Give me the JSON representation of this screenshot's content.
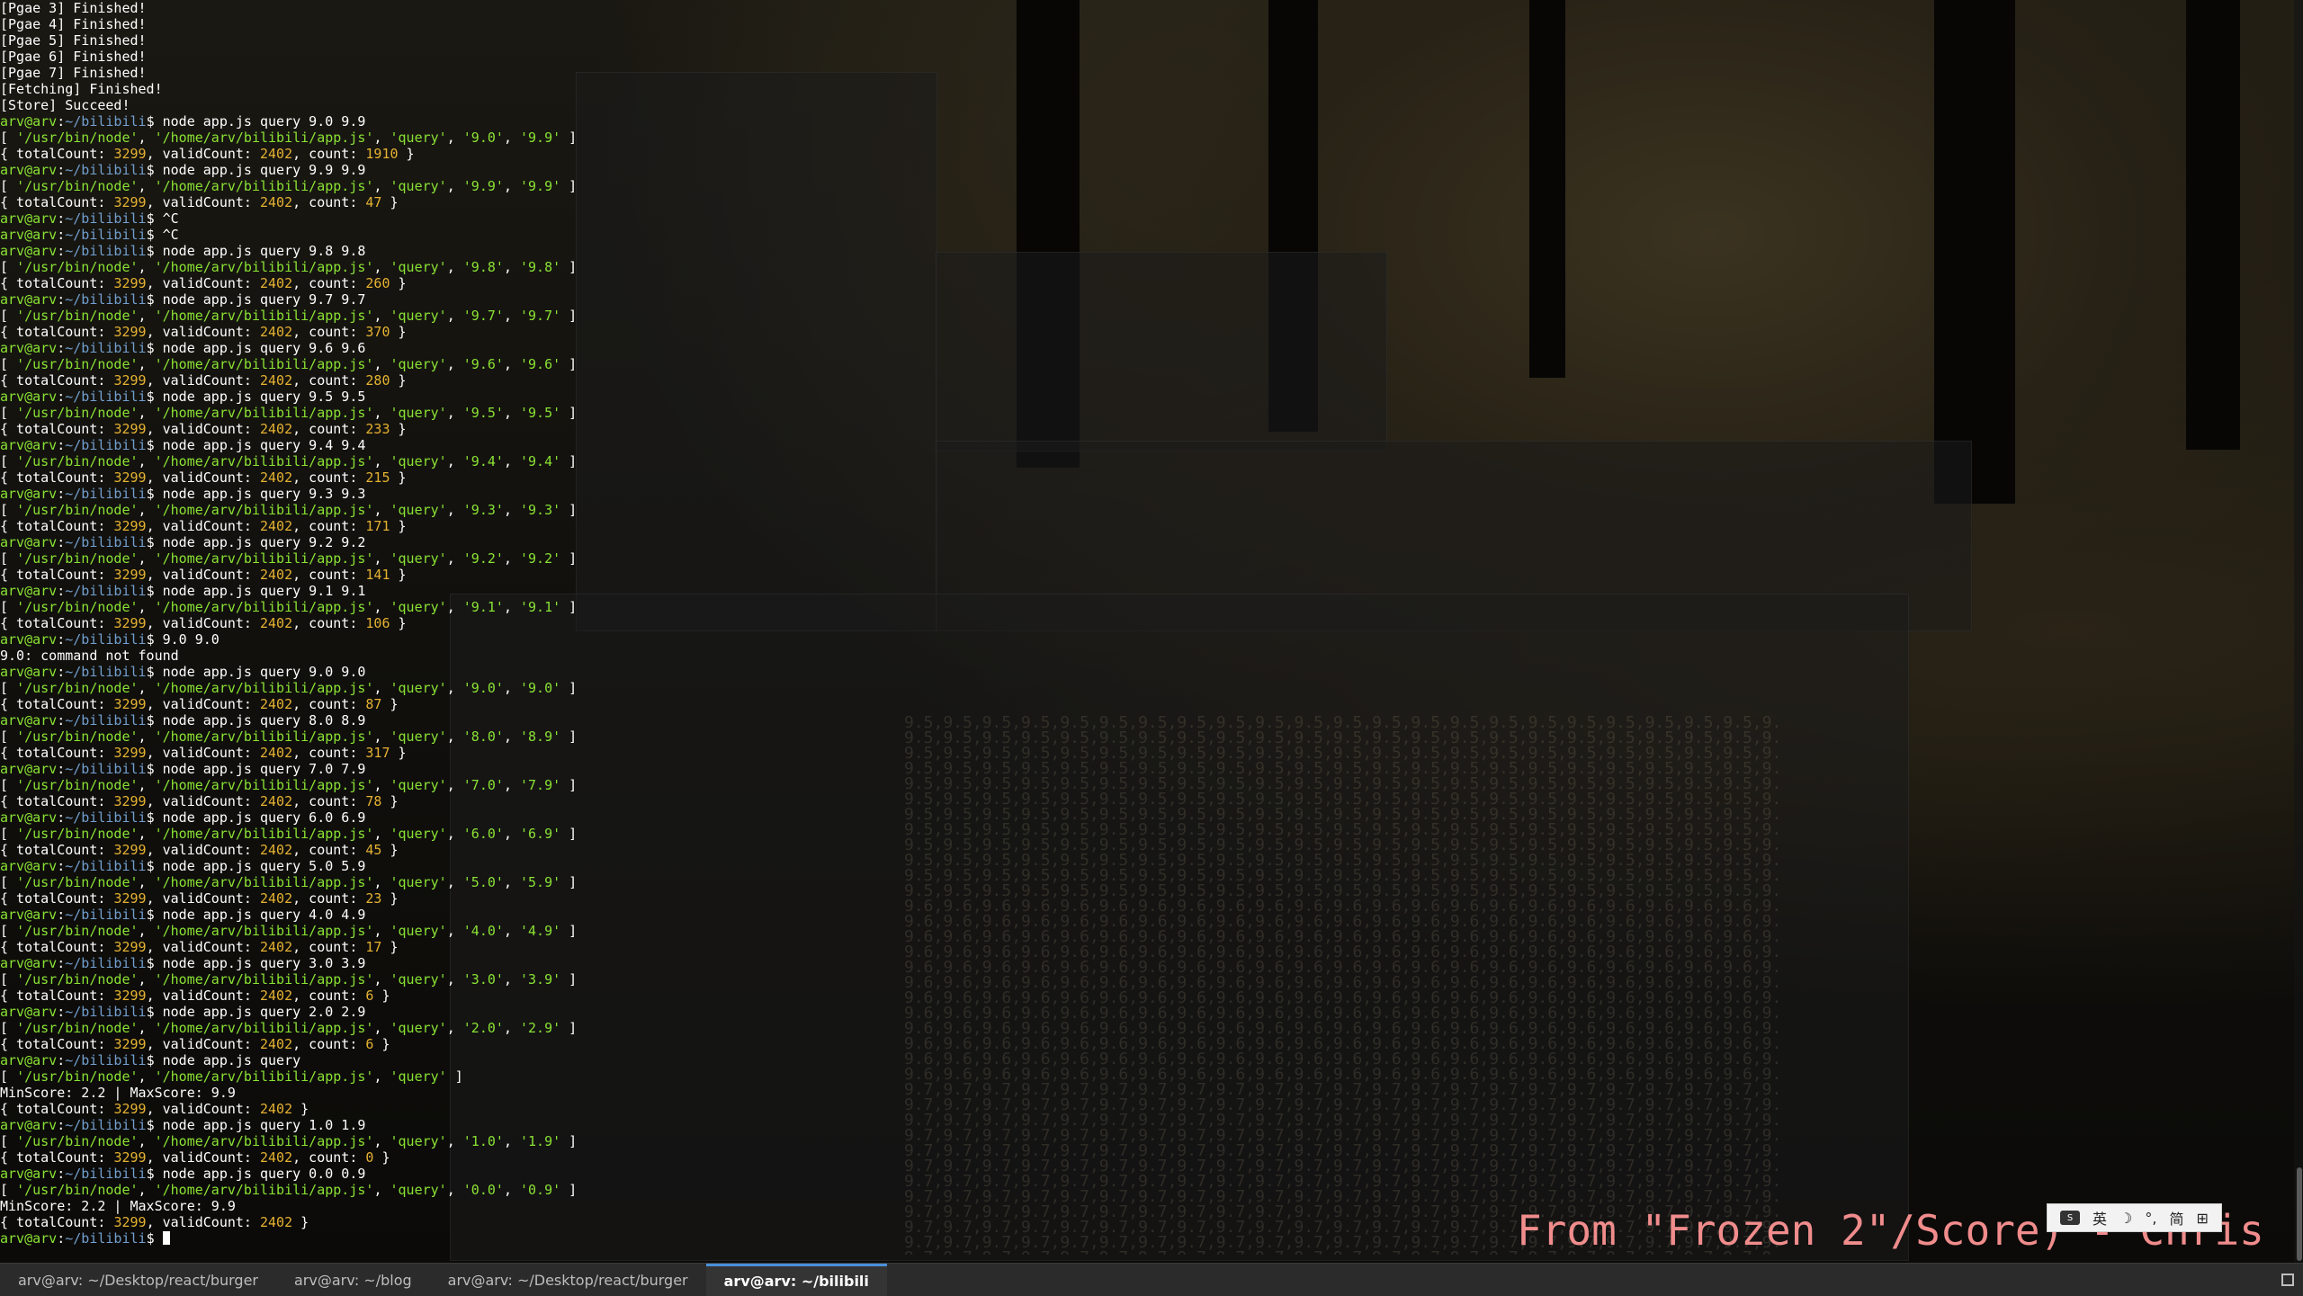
{
  "terminal": {
    "lines": [
      {
        "t": "text",
        "text": "[Pgae 3] Finished!"
      },
      {
        "t": "text",
        "text": "[Pgae 4] Finished!"
      },
      {
        "t": "text",
        "text": "[Pgae 5] Finished!"
      },
      {
        "t": "text",
        "text": "[Pgae 6] Finished!"
      },
      {
        "t": "text",
        "text": "[Pgae 7] Finished!"
      },
      {
        "t": "text",
        "text": "[Fetching] Finished!"
      },
      {
        "t": "text",
        "text": "[Store] Succeed!"
      },
      {
        "t": "prompt",
        "cmd": "node app.js query 9.0 9.9"
      },
      {
        "t": "args",
        "a": "9.0",
        "b": "9.9"
      },
      {
        "t": "result",
        "count": "1910"
      },
      {
        "t": "prompt",
        "cmd": "node app.js query 9.9 9.9"
      },
      {
        "t": "args",
        "a": "9.9",
        "b": "9.9"
      },
      {
        "t": "result",
        "count": "47"
      },
      {
        "t": "prompt",
        "cmd": "^C"
      },
      {
        "t": "prompt",
        "cmd": "^C"
      },
      {
        "t": "prompt",
        "cmd": "node app.js query 9.8 9.8"
      },
      {
        "t": "args",
        "a": "9.8",
        "b": "9.8"
      },
      {
        "t": "result",
        "count": "260"
      },
      {
        "t": "prompt",
        "cmd": "node app.js query 9.7 9.7"
      },
      {
        "t": "args",
        "a": "9.7",
        "b": "9.7"
      },
      {
        "t": "result",
        "count": "370"
      },
      {
        "t": "prompt",
        "cmd": "node app.js query 9.6 9.6"
      },
      {
        "t": "args",
        "a": "9.6",
        "b": "9.6"
      },
      {
        "t": "result",
        "count": "280"
      },
      {
        "t": "prompt",
        "cmd": "node app.js query 9.5 9.5"
      },
      {
        "t": "args",
        "a": "9.5",
        "b": "9.5"
      },
      {
        "t": "result",
        "count": "233"
      },
      {
        "t": "prompt",
        "cmd": "node app.js query 9.4 9.4"
      },
      {
        "t": "args",
        "a": "9.4",
        "b": "9.4"
      },
      {
        "t": "result",
        "count": "215"
      },
      {
        "t": "prompt",
        "cmd": "node app.js query 9.3 9.3"
      },
      {
        "t": "args",
        "a": "9.3",
        "b": "9.3"
      },
      {
        "t": "result",
        "count": "171"
      },
      {
        "t": "prompt",
        "cmd": "node app.js query 9.2 9.2"
      },
      {
        "t": "args",
        "a": "9.2",
        "b": "9.2"
      },
      {
        "t": "result",
        "count": "141"
      },
      {
        "t": "prompt",
        "cmd": "node app.js query 9.1 9.1"
      },
      {
        "t": "args",
        "a": "9.1",
        "b": "9.1"
      },
      {
        "t": "result",
        "count": "106"
      },
      {
        "t": "prompt",
        "cmd": "9.0 9.0"
      },
      {
        "t": "text",
        "text": "9.0: command not found"
      },
      {
        "t": "prompt",
        "cmd": "node app.js query 9.0 9.0"
      },
      {
        "t": "args",
        "a": "9.0",
        "b": "9.0"
      },
      {
        "t": "result",
        "count": "87"
      },
      {
        "t": "prompt",
        "cmd": "node app.js query 8.0 8.9"
      },
      {
        "t": "args",
        "a": "8.0",
        "b": "8.9"
      },
      {
        "t": "result",
        "count": "317"
      },
      {
        "t": "prompt",
        "cmd": "node app.js query 7.0 7.9"
      },
      {
        "t": "args",
        "a": "7.0",
        "b": "7.9"
      },
      {
        "t": "result",
        "count": "78"
      },
      {
        "t": "prompt",
        "cmd": "node app.js query 6.0 6.9"
      },
      {
        "t": "args",
        "a": "6.0",
        "b": "6.9"
      },
      {
        "t": "result",
        "count": "45"
      },
      {
        "t": "prompt",
        "cmd": "node app.js query 5.0 5.9"
      },
      {
        "t": "args",
        "a": "5.0",
        "b": "5.9"
      },
      {
        "t": "result",
        "count": "23"
      },
      {
        "t": "prompt",
        "cmd": "node app.js query 4.0 4.9"
      },
      {
        "t": "args",
        "a": "4.0",
        "b": "4.9"
      },
      {
        "t": "result",
        "count": "17"
      },
      {
        "t": "prompt",
        "cmd": "node app.js query 3.0 3.9"
      },
      {
        "t": "args",
        "a": "3.0",
        "b": "3.9"
      },
      {
        "t": "result",
        "count": "6"
      },
      {
        "t": "prompt",
        "cmd": "node app.js query 2.0 2.9"
      },
      {
        "t": "args",
        "a": "2.0",
        "b": "2.9"
      },
      {
        "t": "result",
        "count": "6"
      },
      {
        "t": "prompt",
        "cmd": "node app.js query"
      },
      {
        "t": "args0"
      },
      {
        "t": "text",
        "text": "MinScore: 2.2 | MaxScore: 9.9"
      },
      {
        "t": "result0"
      },
      {
        "t": "prompt",
        "cmd": "node app.js query 1.0 1.9"
      },
      {
        "t": "args",
        "a": "1.0",
        "b": "1.9"
      },
      {
        "t": "result",
        "count": "0"
      },
      {
        "t": "prompt",
        "cmd": "node app.js query 0.0 0.9"
      },
      {
        "t": "args",
        "a": "0.0",
        "b": "0.9"
      },
      {
        "t": "text",
        "text": "MinScore: 2.2 | MaxScore: 9.9"
      },
      {
        "t": "result0"
      },
      {
        "t": "prompt",
        "cmd": ""
      }
    ],
    "prompt_user": "arv@arv",
    "prompt_path": ":~/bilibili",
    "prompt_symbol": "$ ",
    "args_prefix": "[ '/usr/bin/node', '/home/arv/bilibili/app.js', 'query'",
    "total_count": "3299",
    "valid_count": "2402"
  },
  "tabs": [
    {
      "label": "arv@arv: ~/Desktop/react/burger",
      "active": false
    },
    {
      "label": "arv@arv: ~/blog",
      "active": false
    },
    {
      "label": "arv@arv: ~/Desktop/react/burger",
      "active": false
    },
    {
      "label": "arv@arv: ~/bilibili",
      "active": true
    }
  ],
  "ime": {
    "lang": "英",
    "moon": "☽",
    "punct": "°,",
    "simp": "简"
  },
  "lyric": "From \"Frozen 2\"/Score) - Chris",
  "colors": {
    "prompt_user": "#8ae234",
    "prompt_path": "#729fcf",
    "string": "#8ae234",
    "number": "#e5b232",
    "lyric": "#f08c8c"
  }
}
